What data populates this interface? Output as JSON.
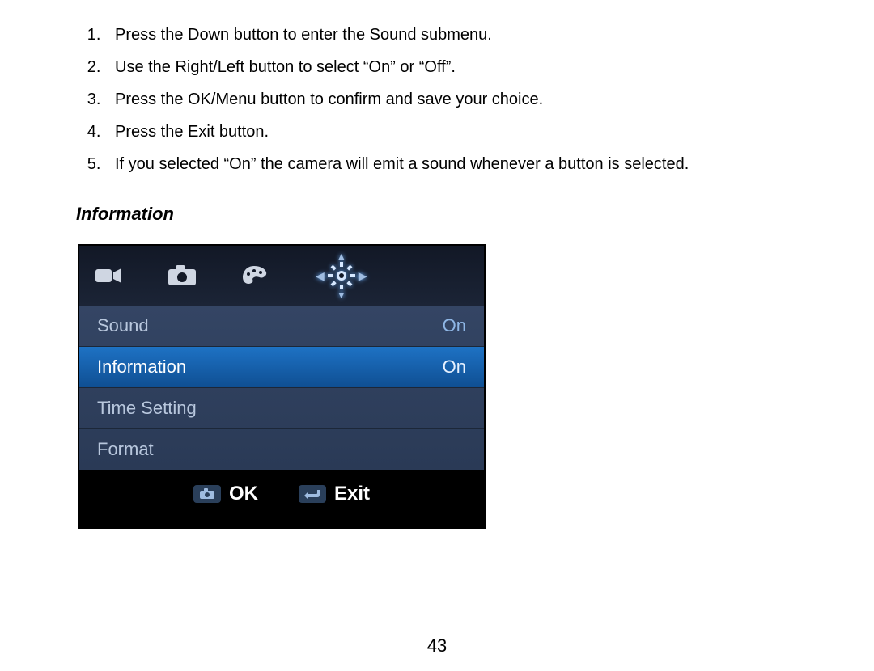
{
  "instructions": [
    "Press the Down button to enter the Sound submenu.",
    "Use the Right/Left button to select “On” or “Off”.",
    "Press the OK/Menu button to confirm and save your choice.",
    "Press the Exit button.",
    "If you selected “On” the camera will emit a sound whenever a button is selected."
  ],
  "section_heading": "Information",
  "camera_menu": {
    "tabs": [
      {
        "name": "video-icon"
      },
      {
        "name": "camera-icon"
      },
      {
        "name": "palette-icon"
      },
      {
        "name": "gear-icon",
        "active": true
      }
    ],
    "rows": [
      {
        "label": "Sound",
        "value": "On",
        "selected": false
      },
      {
        "label": "Information",
        "value": "On",
        "selected": true
      },
      {
        "label": "Time Setting",
        "value": "",
        "selected": false
      },
      {
        "label": "Format",
        "value": "",
        "selected": false
      }
    ],
    "footer": {
      "ok": "OK",
      "exit": "Exit"
    }
  },
  "page_number": "43"
}
